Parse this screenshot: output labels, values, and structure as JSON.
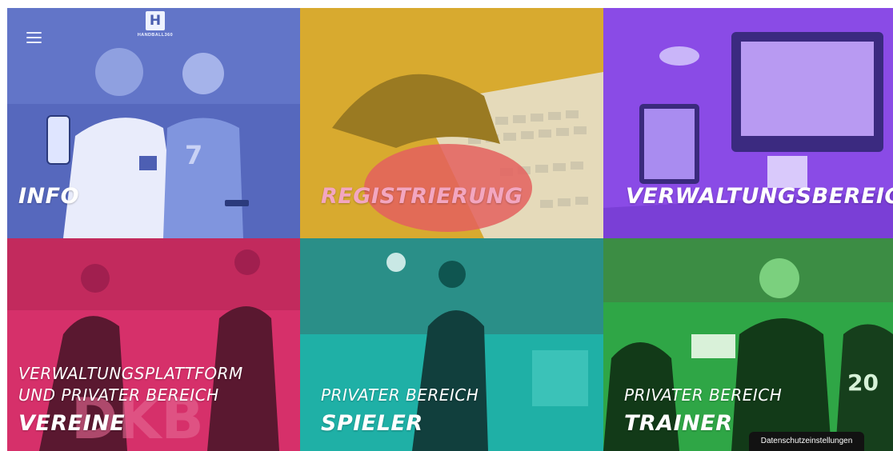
{
  "brand": {
    "logo_text": "HANDBALL360",
    "logo_mark": "H"
  },
  "tiles": {
    "info": {
      "title": "INFO",
      "color": "#5b6fc4"
    },
    "registrierung": {
      "title": "REGISTRIERUNG",
      "color": "#d6a72e"
    },
    "verwaltung": {
      "title": "VERWALTUNGSBEREIC",
      "color": "#8a46e6"
    },
    "vereine": {
      "subtitle_line1": "VERWALTUNGSPLATTFORM",
      "subtitle_line2": "UND PRIVATER BEREICH",
      "title": "VEREINE",
      "color": "#d9336b"
    },
    "spieler": {
      "subtitle": "PRIVATER BEREICH",
      "title": "SPIELER",
      "color": "#1fb3a8"
    },
    "trainer": {
      "subtitle": "PRIVATER BEREICH",
      "title": "TRAINER",
      "color": "#33b04a"
    }
  },
  "cookie_button": {
    "label": "Datenschutzeinstellungen"
  }
}
